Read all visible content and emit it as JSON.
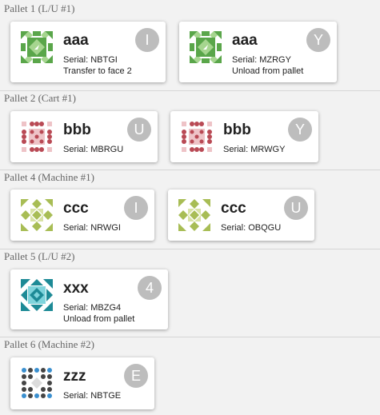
{
  "pallets": [
    {
      "header": "Pallet 1 (L/U #1)",
      "cards": [
        {
          "name": "aaa",
          "serial": "Serial: NBTGI",
          "action": "Transfer to face 2",
          "badge": "I",
          "icon": "green-diamond-pattern-icon"
        },
        {
          "name": "aaa",
          "serial": "Serial: MZRGY",
          "action": "Unload from pallet",
          "badge": "Y",
          "icon": "green-diamond-pattern-icon"
        }
      ]
    },
    {
      "header": "Pallet 2 (Cart #1)",
      "cards": [
        {
          "name": "bbb",
          "serial": "Serial: MBRGU",
          "badge": "U",
          "icon": "red-dot-pattern-icon"
        },
        {
          "name": "bbb",
          "serial": "Serial: MRWGY",
          "badge": "Y",
          "icon": "red-dot-pattern-icon"
        }
      ]
    },
    {
      "header": "Pallet 4 (Machine #1)",
      "cards": [
        {
          "name": "ccc",
          "serial": "Serial: NRWGI",
          "badge": "I",
          "icon": "olive-triangle-pattern-icon"
        },
        {
          "name": "ccc",
          "serial": "Serial: OBQGU",
          "badge": "U",
          "icon": "olive-triangle-pattern-icon"
        }
      ]
    },
    {
      "header": "Pallet 5 (L/U #2)",
      "cards": [
        {
          "name": "xxx",
          "serial": "Serial: MBZG4",
          "action": "Unload from pallet",
          "badge": "4",
          "icon": "teal-star-pattern-icon"
        }
      ]
    },
    {
      "header": "Pallet 6 (Machine #2)",
      "cards": [
        {
          "name": "zzz",
          "serial": "Serial: NBTGE",
          "badge": "E",
          "icon": "blue-dot-pattern-icon"
        }
      ]
    }
  ],
  "colors": {
    "green": "#5aa64a",
    "green_light": "#a6d58f",
    "red": "#b94a55",
    "red_light": "#eec3c7",
    "olive": "#a8bd55",
    "olive_light": "#d9e3a5",
    "teal": "#1d8a96",
    "teal_light": "#7fd4dc",
    "blue": "#3a8fcf",
    "dark": "#444444"
  }
}
